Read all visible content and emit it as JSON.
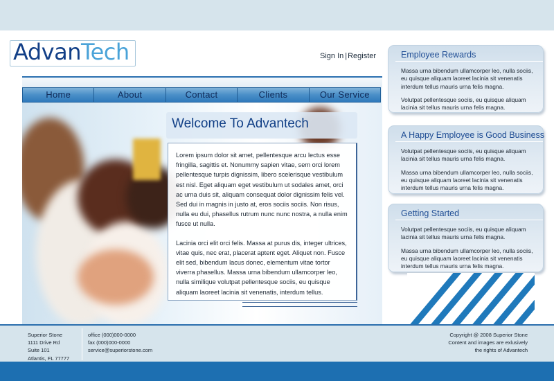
{
  "brand": {
    "logo_part1": "Advan",
    "logo_part2": "Tech",
    "primary_color": "#123f87",
    "accent_color": "#4aa3d8"
  },
  "auth": {
    "signin": "Sign In",
    "separator": "|",
    "register": "Register"
  },
  "nav": {
    "items": [
      "Home",
      "About",
      "Contact",
      "Clients",
      "Our Service"
    ]
  },
  "main": {
    "title": "Welcome To Advantech",
    "paragraphs": [
      "Lorem ipsum dolor sit amet, pellentesque arcu lectus esse fringilla, sagittis et. Nonummy sapien vitae, sem orci lorem pellentesque turpis dignissim, libero scelerisque vestibulum est nisl. Eget aliquam eget vestibulum ut sodales amet, orci ac urna duis sit, aliquam consequat dolor dignissim felis vel. Sed dui in magnis in justo at, eros sociis sociis. Non risus, nulla eu dui, phasellus rutrum nunc nunc nostra, a nulla enim fusce ut nulla.",
      "Lacinia orci elit orci felis. Massa at purus dis, integer ultrices, vitae quis, nec erat, placerat aptent eget. Aliquet non. Fusce elit sed, bibendum lacus donec, elementum vitae tortor viverra phasellus. Massa urna bibendum ullamcorper leo, nulla similique volutpat pellentesque sociis, eu quisque aliquam laoreet lacinia sit venenatis, interdum tellus."
    ]
  },
  "sidebar": [
    {
      "title": "Employee Rewards",
      "paragraphs": [
        "Massa urna bibendum ullamcorper leo, nulla sociis, eu quisque aliquam laoreet lacinia sit venenatis interdum tellus mauris urna felis magna.",
        "Volutpat pellentesque sociis, eu quisque aliquam lacinia sit tellus mauris urna felis magna."
      ]
    },
    {
      "title": "A Happy Employee is Good Business",
      "paragraphs": [
        "Volutpat pellentesque sociis, eu quisque aliquam lacinia sit tellus mauris urna felis magna.",
        "Massa urna bibendum ullamcorper leo, nulla sociis, eu quisque aliquam laoreet lacinia sit venenatis interdum tellus mauris urna felis magna."
      ]
    },
    {
      "title": "Getting Started",
      "paragraphs": [
        "Volutpat pellentesque sociis, eu quisque aliquam lacinia sit tellus mauris urna felis magna.",
        "Massa urna bibendum ullamcorper leo, nulla sociis, eu quisque aliquam laoreet lacinia sit venenatis interdum tellus mauris urna felis magna."
      ]
    }
  ],
  "footer": {
    "address": [
      "Superior Stone",
      "1111 Drive Rd",
      "Suite 101",
      "Atlantis, FL 77777"
    ],
    "contact": [
      "office (000)000-0000",
      "fax (000)000-0000",
      "service@superiorstone.com"
    ],
    "copyright": [
      "Copyright @ 2008 Superior Stone",
      "Content and images are exlusively",
      "the rights of Advantech"
    ]
  }
}
